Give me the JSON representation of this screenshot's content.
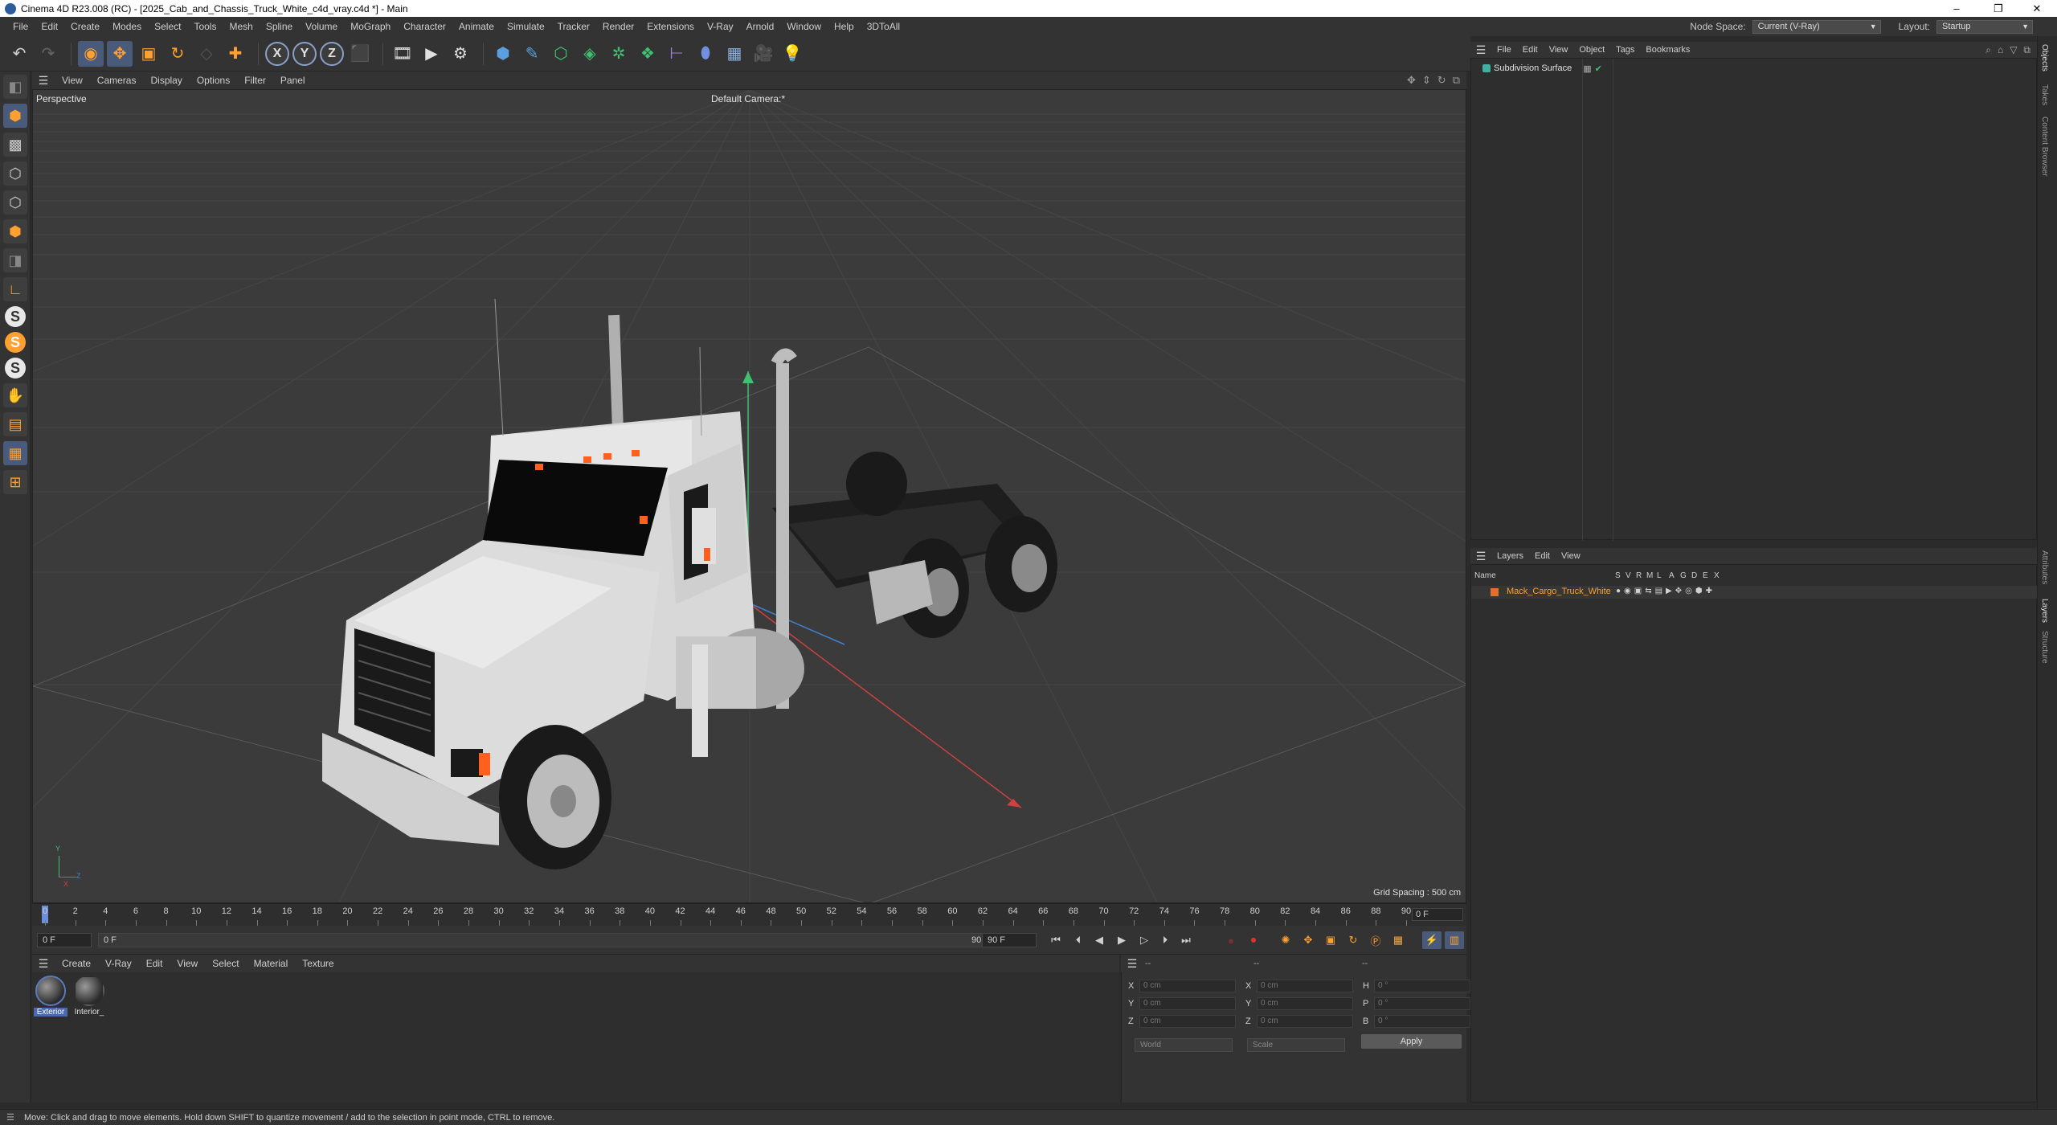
{
  "window": {
    "title": "Cinema 4D R23.008 (RC) - [2025_Cab_and_Chassis_Truck_White_c4d_vray.c4d *] - Main",
    "minimize": "–",
    "restore": "❐",
    "close": "✕"
  },
  "menubar": {
    "items": [
      "File",
      "Edit",
      "Create",
      "Modes",
      "Select",
      "Tools",
      "Mesh",
      "Spline",
      "Volume",
      "MoGraph",
      "Character",
      "Animate",
      "Simulate",
      "Tracker",
      "Render",
      "Extensions",
      "V-Ray",
      "Arnold",
      "Window",
      "Help",
      "3DToAll"
    ],
    "node_space_label": "Node Space:",
    "node_space_value": "Current (V-Ray)",
    "layout_label": "Layout:",
    "layout_value": "Startup"
  },
  "toolbar": {
    "axis_x": "X",
    "axis_y": "Y",
    "axis_z": "Z"
  },
  "lefttools": {
    "s1": "S",
    "s2": "S",
    "s3": "S"
  },
  "viewport": {
    "menu": [
      "View",
      "Cameras",
      "Display",
      "Options",
      "Filter",
      "Panel"
    ],
    "projection_label": "Perspective",
    "camera_label": "Default Camera:*",
    "grid_spacing": "Grid Spacing : 500 cm",
    "axis_x": "X",
    "axis_y": "Y",
    "axis_z": "Z"
  },
  "timeline": {
    "ticks": [
      "0",
      "2",
      "4",
      "6",
      "8",
      "10",
      "12",
      "14",
      "16",
      "18",
      "20",
      "22",
      "24",
      "26",
      "28",
      "30",
      "32",
      "34",
      "36",
      "38",
      "40",
      "42",
      "44",
      "46",
      "48",
      "50",
      "52",
      "54",
      "56",
      "58",
      "60",
      "62",
      "64",
      "66",
      "68",
      "70",
      "72",
      "74",
      "76",
      "78",
      "80",
      "82",
      "84",
      "86",
      "88",
      "90"
    ],
    "current_frame": "0 F"
  },
  "transport": {
    "start_frame": "0 F",
    "preview_start": "0 F",
    "preview_end": "90 F",
    "end_frame": "90 F"
  },
  "material_manager": {
    "menu": [
      "Create",
      "V-Ray",
      "Edit",
      "View",
      "Select",
      "Material",
      "Texture"
    ],
    "materials": [
      {
        "name": "Exterior",
        "selected": true
      },
      {
        "name": "Interior_",
        "selected": false
      }
    ]
  },
  "coordinates": {
    "header_dashes": [
      "--",
      "--",
      "--"
    ],
    "rows": [
      {
        "l1": "X",
        "v1": "0 cm",
        "l2": "X",
        "v2": "0 cm",
        "l3": "H",
        "v3": "0 °"
      },
      {
        "l1": "Y",
        "v1": "0 cm",
        "l2": "Y",
        "v2": "0 cm",
        "l3": "P",
        "v3": "0 °"
      },
      {
        "l1": "Z",
        "v1": "0 cm",
        "l2": "Z",
        "v2": "0 cm",
        "l3": "B",
        "v3": "0 °"
      }
    ],
    "mode": "World",
    "transform": "Scale",
    "apply": "Apply"
  },
  "object_manager": {
    "menu": [
      "File",
      "Edit",
      "View",
      "Object",
      "Tags",
      "Bookmarks"
    ],
    "objects": [
      {
        "name": "Subdivision Surface"
      }
    ]
  },
  "layers": {
    "menu": [
      "Layers",
      "Edit",
      "View"
    ],
    "columns": [
      "Name",
      "S",
      "V",
      "R",
      "M",
      "L",
      "A",
      "G",
      "D",
      "E",
      "X"
    ],
    "rows": [
      {
        "name": "Mack_Cargo_Truck_White",
        "color": "#e07030"
      }
    ]
  },
  "vertical_tabs": [
    "Objects",
    "Takes",
    "Content Browser",
    "Attributes",
    "Layers",
    "Structure"
  ],
  "status": {
    "message": "Move: Click and drag to move elements. Hold down SHIFT to quantize movement / add to the selection in point mode, CTRL to remove."
  },
  "colors": {
    "accent_orange": "#ffa030",
    "selection_blue": "#4a6ab0",
    "background": "#2b2b2b",
    "viewport": "#3b3b3b"
  }
}
